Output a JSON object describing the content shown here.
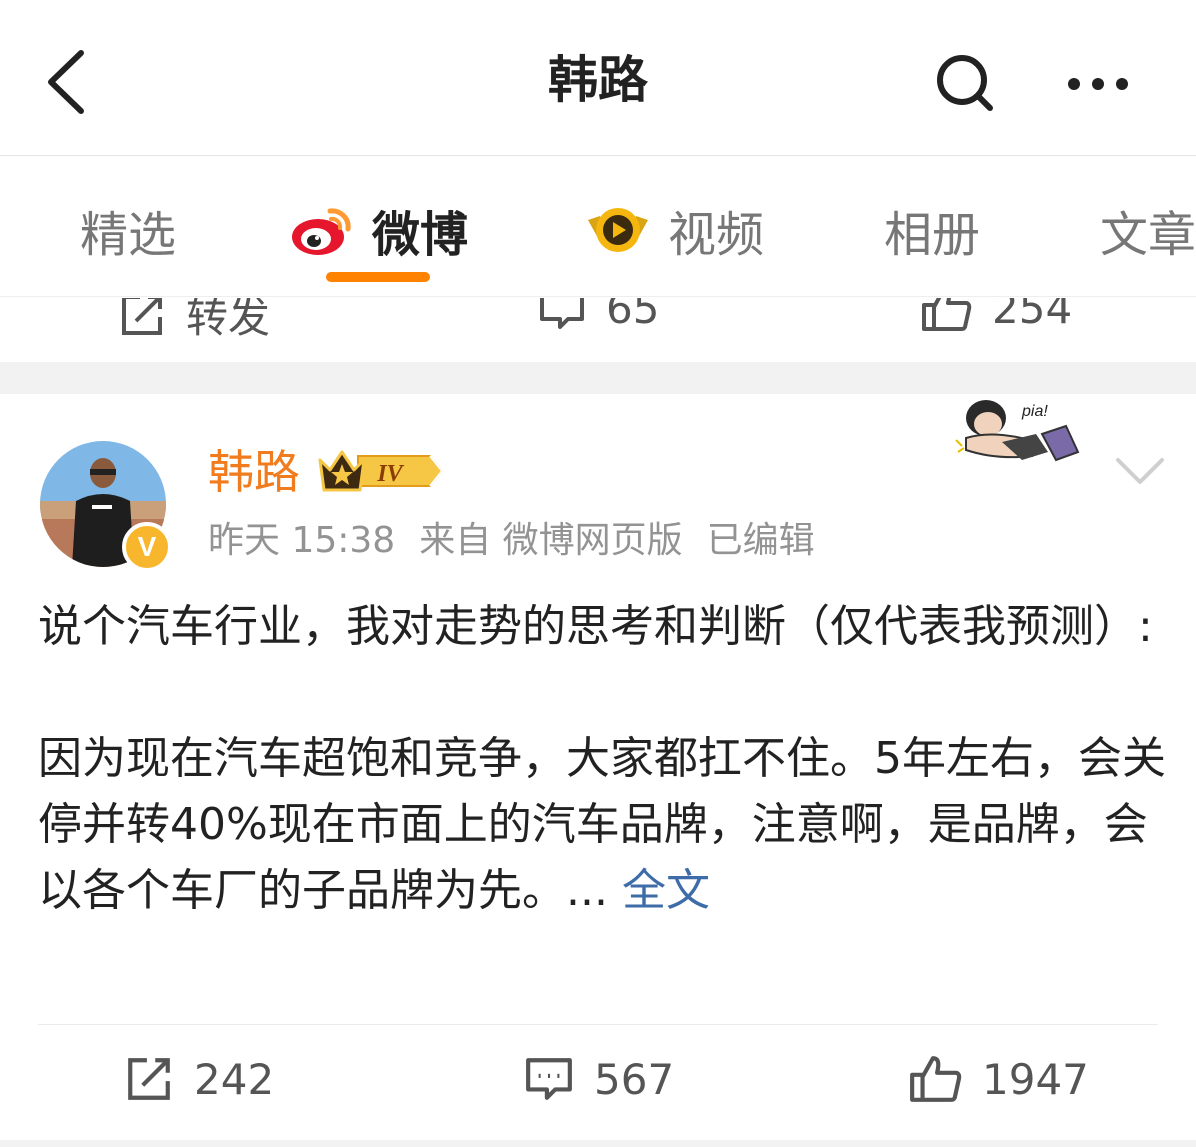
{
  "header": {
    "title": "韩路",
    "back_icon": "chevron-left-icon",
    "search_icon": "search-icon",
    "more_icon": "more-horizontal-icon"
  },
  "tabs": [
    {
      "label": "精选",
      "active": false
    },
    {
      "label": "微博",
      "active": true,
      "icon": "weibo-logo-icon"
    },
    {
      "label": "视频",
      "active": false,
      "icon": "video-play-badge-icon"
    },
    {
      "label": "相册",
      "active": false
    },
    {
      "label": "文章",
      "active": false
    }
  ],
  "accent_color": "#ff8200",
  "previous_post_actions": {
    "repost_label": "转发",
    "comments": "65",
    "likes": "254"
  },
  "post": {
    "username": "韩路",
    "vip_level": "IV",
    "verified_badge": "V",
    "time": "昨天 15:38",
    "source": "来自 微博网页版",
    "edited": "已编辑",
    "paragraph1": "说个汽车行业，我对走势的思考和判断（仅代表我预测）:",
    "paragraph2": "因为现在汽车超饱和竞争，大家都扛不住。5年左右，会关停并转40%现在市面上的汽车品牌，注意啊，是品牌，会以各个车厂的子品牌为先。...",
    "full_text_link": "全文",
    "sticker_text": "pia!",
    "reposts": "242",
    "comments": "567",
    "likes": "1947"
  }
}
